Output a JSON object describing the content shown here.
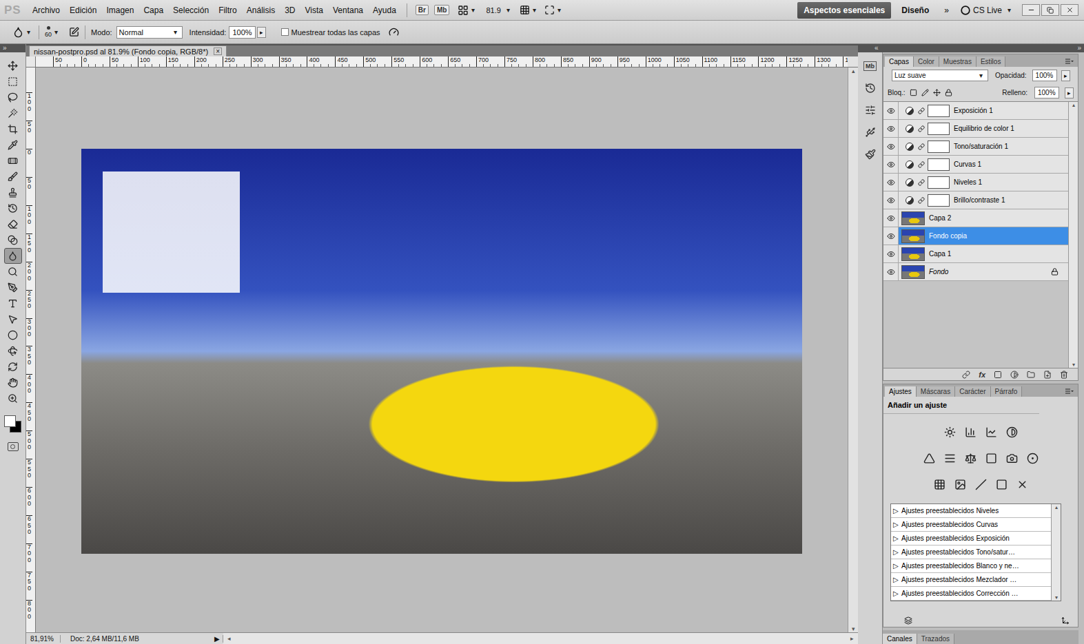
{
  "app": {
    "logo": "PS"
  },
  "menu": [
    "Archivo",
    "Edición",
    "Imagen",
    "Capa",
    "Selección",
    "Filtro",
    "Análisis",
    "3D",
    "Vista",
    "Ventana",
    "Ayuda"
  ],
  "app_bar": {
    "bridge": "Br",
    "mini_bridge": "Mb",
    "zoom": "81.9",
    "arrow": "▾",
    "workspaces": [
      {
        "label": "Aspectos esenciales",
        "selected": true
      },
      {
        "label": "Diseño",
        "selected": false
      }
    ],
    "more": "»",
    "cs_live": "CS Live"
  },
  "options_bar": {
    "brush_size": "60",
    "mode_label": "Modo:",
    "mode": "Normal",
    "strength_label": "Intensidad:",
    "strength": "100%",
    "stepper": "▸",
    "sample_all": {
      "label": "Muestrear todas las capas",
      "checked": false
    }
  },
  "dock_strip": {
    "left": "»",
    "middle": "«",
    "right": "»"
  },
  "tools": [
    {
      "selected": false
    },
    {
      "selected": false
    },
    {
      "selected": false
    },
    {
      "selected": false
    },
    {
      "selected": false
    },
    {
      "selected": false
    },
    {
      "selected": false
    },
    {
      "selected": false
    },
    {
      "selected": false
    },
    {
      "selected": false
    },
    {
      "selected": false
    },
    {
      "selected": false
    },
    {
      "selected": true
    },
    {
      "selected": false
    },
    {
      "selected": false
    },
    {
      "selected": false
    },
    {
      "selected": false
    },
    {
      "selected": false
    },
    {
      "selected": false
    },
    {
      "selected": false
    },
    {
      "selected": false
    },
    {
      "selected": false
    }
  ],
  "colors": {
    "foreground": "#ffffff",
    "background": "#000000"
  },
  "document": {
    "tab": "nissan-postpro.psd al 81.9% (Fondo copia, RGB/8*)",
    "close": "×",
    "h_ruler": [
      "50",
      "0",
      "50",
      "100",
      "150",
      "200",
      "250",
      "300",
      "350",
      "400",
      "450",
      "500",
      "550",
      "600",
      "650",
      "700",
      "750",
      "800",
      "850",
      "900",
      "950",
      "1000",
      "1050",
      "1100",
      "1150",
      "1200",
      "1250",
      "1300",
      "1"
    ],
    "v_ruler": [
      "100",
      "50",
      "0",
      "50",
      "100",
      "150",
      "200",
      "250",
      "300",
      "350",
      "400",
      "450",
      "500",
      "550",
      "600",
      "650",
      "700",
      "750",
      "800"
    ],
    "scroll_up": "▴",
    "scroll_down": "▾",
    "scroll_left": "◂",
    "scroll_right": "▸",
    "status_zoom": "81,91%",
    "status_doc": "Doc: 2,64 MB/11,6 MB",
    "status_arrow": "▶"
  },
  "dock_icon_label": "Mb",
  "layers_panel": {
    "tabs": [
      {
        "label": "Capas",
        "selected": true
      },
      {
        "label": "Color",
        "selected": false
      },
      {
        "label": "Muestras",
        "selected": false
      },
      {
        "label": "Estilos",
        "selected": false
      }
    ],
    "blend_mode": "Luz suave",
    "opacity_label": "Opacidad:",
    "opacity": "100%",
    "lock_label": "Bloq.:",
    "fill_label": "Relleno:",
    "fill": "100%",
    "stepper": "▸",
    "arrow": "▾",
    "layers": [
      {
        "name": "Exposición 1",
        "kind": "adjustment",
        "visible": true,
        "selected": false,
        "locked": false,
        "background": false
      },
      {
        "name": "Equilibrio de color 1",
        "kind": "adjustment",
        "visible": true,
        "selected": false,
        "locked": false,
        "background": false
      },
      {
        "name": "Tono/saturación 1",
        "kind": "adjustment",
        "visible": true,
        "selected": false,
        "locked": false,
        "background": false
      },
      {
        "name": "Curvas 1",
        "kind": "adjustment",
        "visible": true,
        "selected": false,
        "locked": false,
        "background": false
      },
      {
        "name": "Niveles 1",
        "kind": "adjustment",
        "visible": true,
        "selected": false,
        "locked": false,
        "background": false
      },
      {
        "name": "Brillo/contraste 1",
        "kind": "adjustment",
        "visible": true,
        "selected": false,
        "locked": false,
        "background": false
      },
      {
        "name": "Capa 2",
        "kind": "image",
        "visible": true,
        "selected": false,
        "locked": false,
        "background": false
      },
      {
        "name": "Fondo copia",
        "kind": "image",
        "visible": true,
        "selected": true,
        "locked": false,
        "background": false
      },
      {
        "name": "Capa 1",
        "kind": "image",
        "visible": true,
        "selected": false,
        "locked": false,
        "background": false
      },
      {
        "name": "Fondo",
        "kind": "image",
        "visible": true,
        "selected": false,
        "locked": true,
        "background": true
      }
    ],
    "fx": "fx"
  },
  "adjustments_panel": {
    "tabs": [
      {
        "label": "Ajustes",
        "selected": true
      },
      {
        "label": "Máscaras",
        "selected": false
      },
      {
        "label": "Carácter",
        "selected": false
      },
      {
        "label": "Párrafo",
        "selected": false
      }
    ],
    "heading": "Añadir un ajuste",
    "expander": "▷",
    "presets": [
      "Ajustes preestablecidos Niveles",
      "Ajustes preestablecidos Curvas",
      "Ajustes preestablecidos Exposición",
      "Ajustes preestablecidos Tono/satur…",
      "Ajustes preestablecidos Blanco y ne…",
      "Ajustes preestablecidos Mezclador …",
      "Ajustes preestablecidos Corrección …"
    ]
  },
  "bottom_tabs": [
    {
      "label": "Canales",
      "selected": true
    },
    {
      "label": "Trazados",
      "selected": false
    }
  ]
}
